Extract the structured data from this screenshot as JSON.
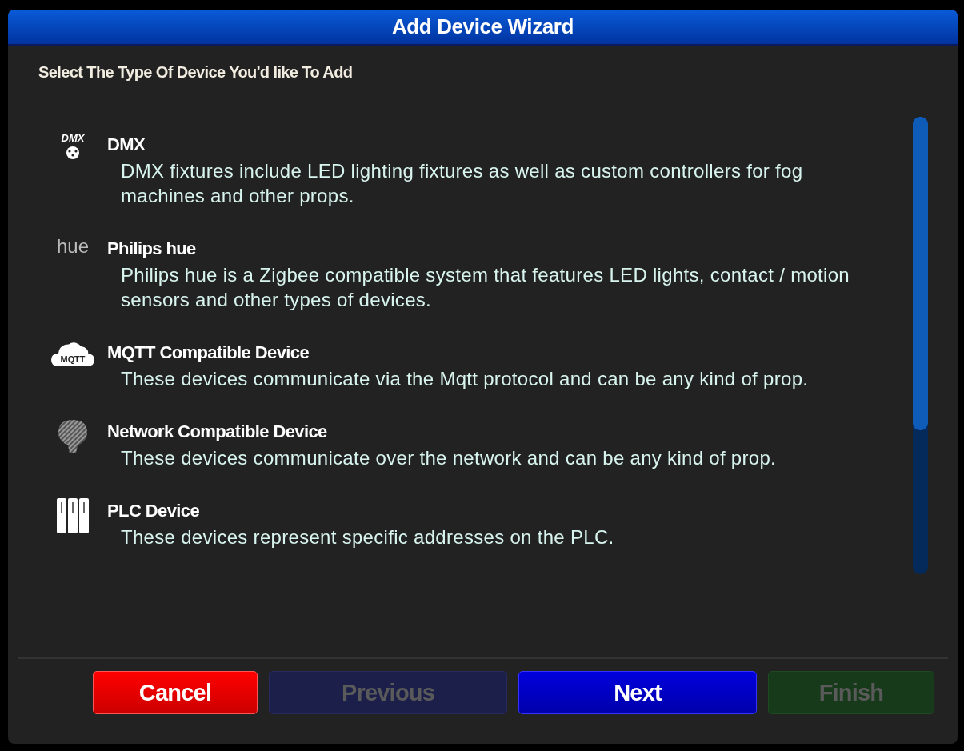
{
  "window": {
    "title": "Add Device Wizard"
  },
  "prompt": "Select The Type Of Device You'd like To Add",
  "device_types": [
    {
      "kind": "dmx",
      "logo": "DMX",
      "name": "DMX",
      "description": "DMX fixtures include LED lighting fixtures as well as custom controllers for fog machines and other props."
    },
    {
      "kind": "hue",
      "logo": "hue",
      "name": "Philips hue",
      "description": "Philips hue is a Zigbee compatible system that features LED lights, contact / motion sensors and other types of devices."
    },
    {
      "kind": "mqtt",
      "logo": "MQTT",
      "name": "MQTT Compatible Device",
      "description": "These devices communicate via the Mqtt protocol and can be any kind of prop."
    },
    {
      "kind": "network",
      "name": "Network Compatible Device",
      "description": "These devices communicate over the network and can be any kind of prop."
    },
    {
      "kind": "plc",
      "name": "PLC Device",
      "description": "These devices represent specific addresses on the PLC."
    }
  ],
  "buttons": [
    {
      "kind": "danger",
      "label": "Cancel",
      "disabled": false
    },
    {
      "kind": "secondary",
      "label": "Previous",
      "disabled": true
    },
    {
      "kind": "primary",
      "label": "Next",
      "disabled": false
    },
    {
      "kind": "success",
      "label": "Finish",
      "disabled": true
    }
  ]
}
